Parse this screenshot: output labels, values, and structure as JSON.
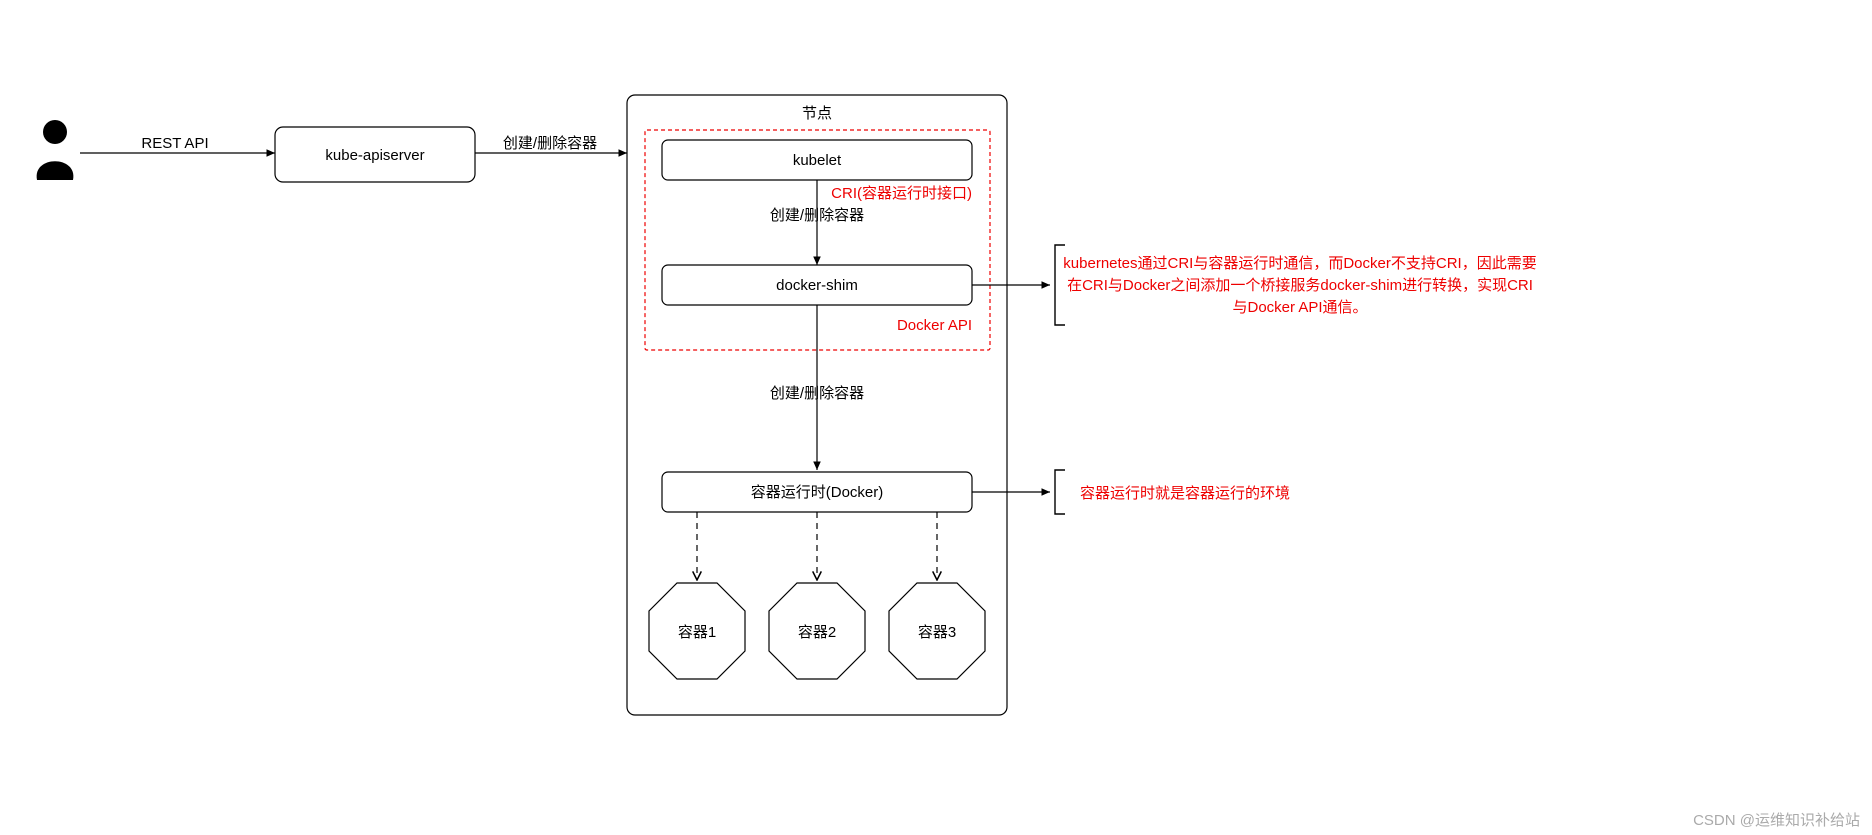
{
  "labels": {
    "rest_api": "REST API",
    "apiserver": "kube-apiserver",
    "create_delete_1": "创建/删除容器",
    "node_title": "节点",
    "kubelet": "kubelet",
    "cri_label": "CRI(容器运行时接口)",
    "create_delete_2": "创建/删除容器",
    "docker_shim": "docker-shim",
    "docker_api": "Docker API",
    "create_delete_3": "创建/删除容器",
    "runtime": "容器运行时(Docker)",
    "container1": "容器1",
    "container2": "容器2",
    "container3": "容器3",
    "note_shim_1": "kubernetes通过CRI与容器运行时通信，而Docker不支持CRI，因此需要",
    "note_shim_2": "在CRI与Docker之间添加一个桥接服务docker-shim进行转换，实现CRI",
    "note_shim_3": "与Docker API通信。",
    "note_runtime": "容器运行时就是容器运行的环境",
    "watermark": "CSDN @运维知识补给站"
  }
}
